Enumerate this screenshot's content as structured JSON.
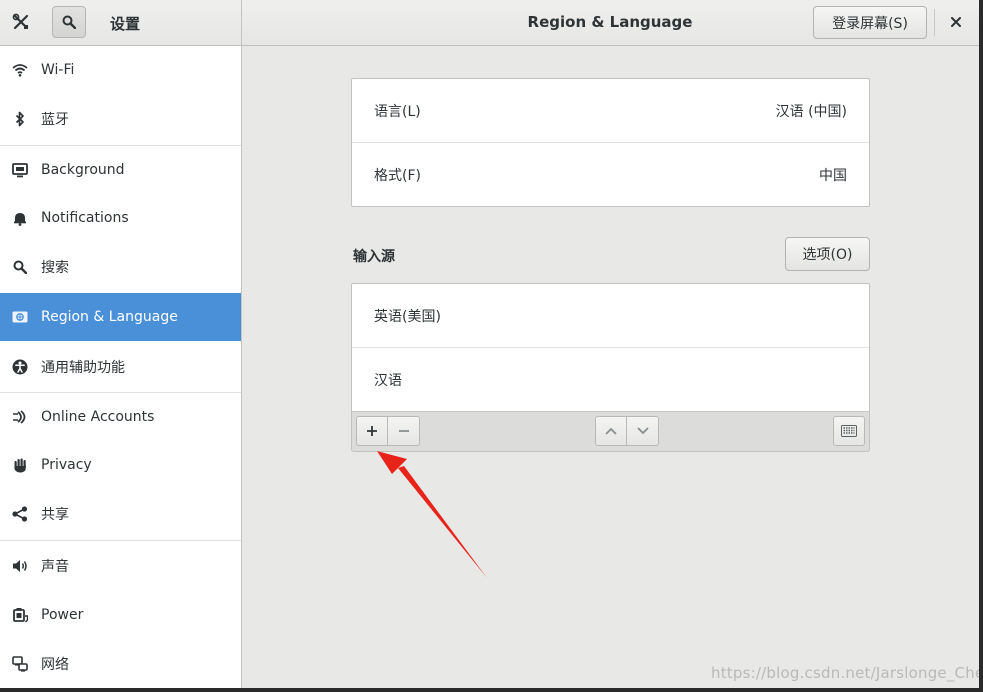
{
  "header": {
    "settings_title": "设置",
    "page_title": "Region & Language",
    "login_screen_label": "登录屏幕(S)"
  },
  "sidebar": {
    "selected": "Region & Language",
    "items": [
      {
        "label": "Wi-Fi",
        "icon": "wifi-icon"
      },
      {
        "label": "蓝牙",
        "icon": "bluetooth-icon"
      },
      {
        "label": "Background",
        "icon": "background-icon"
      },
      {
        "label": "Notifications",
        "icon": "bell-icon"
      },
      {
        "label": "搜索",
        "icon": "search-icon"
      },
      {
        "label": "Region & Language",
        "icon": "region-icon"
      },
      {
        "label": "通用辅助功能",
        "icon": "accessibility-icon"
      },
      {
        "label": "Online Accounts",
        "icon": "online-accounts-icon"
      },
      {
        "label": "Privacy",
        "icon": "privacy-hand-icon"
      },
      {
        "label": "共享",
        "icon": "share-icon"
      },
      {
        "label": "声音",
        "icon": "speaker-icon"
      },
      {
        "label": "Power",
        "icon": "power-icon"
      },
      {
        "label": "网络",
        "icon": "network-icon"
      }
    ]
  },
  "language_card": {
    "language_label": "语言(L)",
    "language_value": "汉语 (中国)",
    "formats_label": "格式(F)",
    "formats_value": "中国"
  },
  "input_sources": {
    "title": "输入源",
    "options_label": "选项(O)",
    "items": [
      "英语(美国)",
      "汉语"
    ]
  },
  "colors": {
    "selected_bg": "#4a90d9",
    "arrow": "#e8231a",
    "window_bg": "#e8e8e7"
  },
  "watermark": "https://blog.csdn.net/Jarslonge_Chen"
}
